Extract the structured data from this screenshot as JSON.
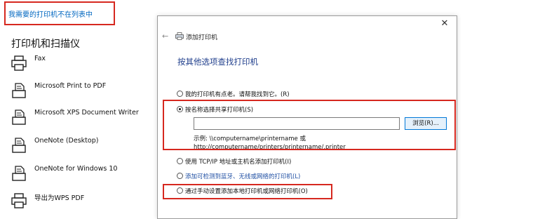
{
  "settings": {
    "missing_printer_link": "我需要的打印机不在列表中",
    "section_title": "打印机和扫描仪",
    "printers": [
      {
        "name": "Fax",
        "icon": "printer-icon"
      },
      {
        "name": "Microsoft Print to PDF",
        "icon": "document-printer-icon"
      },
      {
        "name": "Microsoft XPS Document Writer",
        "icon": "document-printer-icon"
      },
      {
        "name": "OneNote (Desktop)",
        "icon": "document-printer-icon"
      },
      {
        "name": "OneNote for Windows 10",
        "icon": "document-printer-icon"
      },
      {
        "name": "导出为WPS PDF",
        "icon": "printer-icon"
      }
    ]
  },
  "dialog": {
    "close": "✕",
    "back": "←",
    "title": "添加打印机",
    "heading": "按其他选项查找打印机",
    "options": [
      {
        "label": "我的打印机有点老。请帮我找到它。(R)",
        "checked": false
      },
      {
        "label": "按名称选择共享打印机(S)",
        "checked": true
      },
      {
        "label": "使用 TCP/IP 地址或主机名添加打印机(I)",
        "checked": false
      },
      {
        "label": "添加可检测到蓝牙、无线或网络的打印机(L)",
        "checked": false
      },
      {
        "label": "通过手动设置添加本地打印机或网络打印机(O)",
        "checked": false
      }
    ],
    "share_input_value": "",
    "browse_label": "浏览(R)...",
    "example_line1": "示例: \\\\computername\\printername 或",
    "example_line2": "http://computername/printers/printername/.printer"
  },
  "colors": {
    "highlight": "#d6281f",
    "link": "#0067c0",
    "heading": "#1f3e8c"
  }
}
